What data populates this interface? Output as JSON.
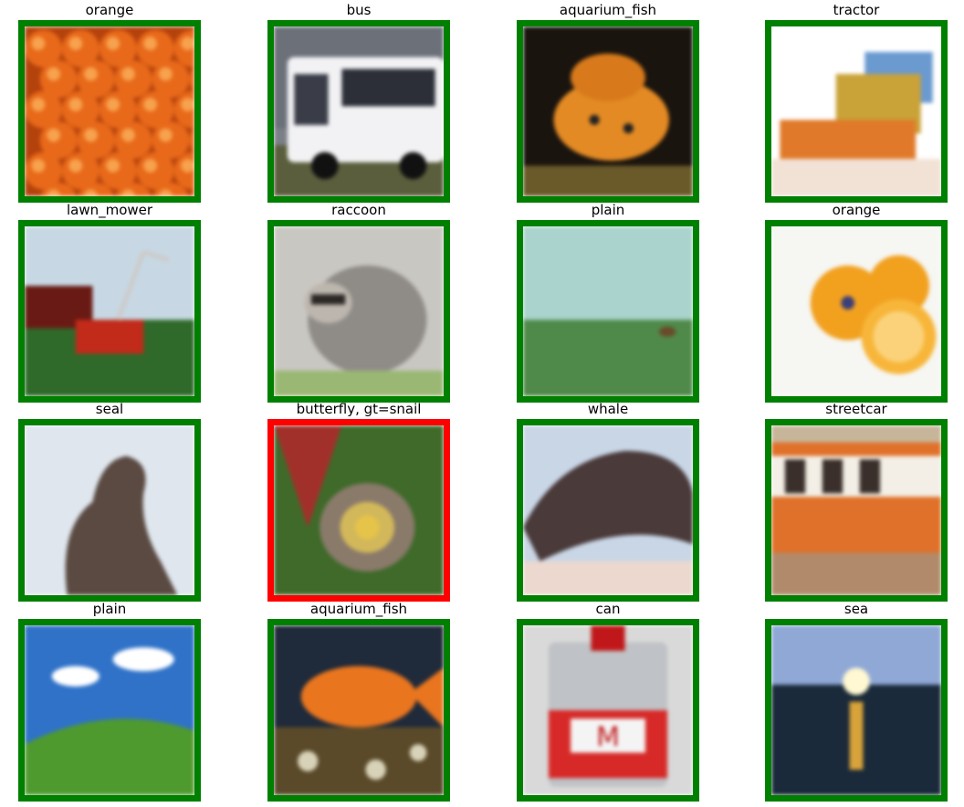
{
  "colors": {
    "correct": "#008000",
    "incorrect": "#ff0000"
  },
  "panels": [
    {
      "title": "orange",
      "correct": true,
      "scene": "oranges-pile"
    },
    {
      "title": "bus",
      "correct": true,
      "scene": "white-bus"
    },
    {
      "title": "aquarium_fish",
      "correct": true,
      "scene": "goldfish-dark"
    },
    {
      "title": "tractor",
      "correct": true,
      "scene": "bulldozer"
    },
    {
      "title": "lawn_mower",
      "correct": true,
      "scene": "red-mower-grass"
    },
    {
      "title": "raccoon",
      "correct": true,
      "scene": "raccoon"
    },
    {
      "title": "plain",
      "correct": true,
      "scene": "misty-field"
    },
    {
      "title": "orange",
      "correct": true,
      "scene": "orange-halves"
    },
    {
      "title": "seal",
      "correct": true,
      "scene": "seal-silhouette"
    },
    {
      "title": "butterfly, gt=snail",
      "correct": false,
      "scene": "snail-leaves"
    },
    {
      "title": "whale",
      "correct": true,
      "scene": "whale-closeup"
    },
    {
      "title": "streetcar",
      "correct": true,
      "scene": "orange-streetcar"
    },
    {
      "title": "plain",
      "correct": true,
      "scene": "green-hill-sky"
    },
    {
      "title": "aquarium_fish",
      "correct": true,
      "scene": "goldfish-pebbles"
    },
    {
      "title": "can",
      "correct": true,
      "scene": "red-tin-can"
    },
    {
      "title": "sea",
      "correct": true,
      "scene": "sunset-sea"
    }
  ]
}
